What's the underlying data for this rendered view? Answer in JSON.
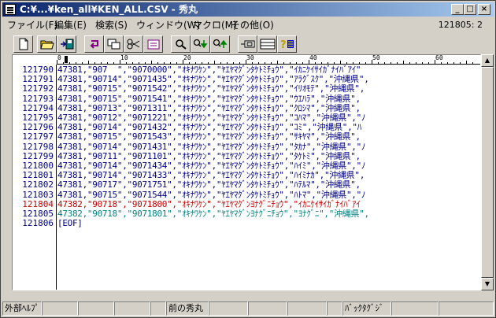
{
  "window": {
    "title": "C:¥...¥ken_all¥KEN_ALL.CSV - 秀丸",
    "minimize": "_",
    "maximize": "□",
    "close": "×"
  },
  "menu": {
    "items": [
      "ファイル(F)",
      "編集(E)",
      "検索(S)",
      "ウィンドウ(W)",
      "マクロ(M)",
      "その他(O)"
    ],
    "position": "121805: 2"
  },
  "toolbar": {
    "icons": [
      "new-file-icon",
      "open-folder-icon",
      "save-icon",
      "undo-icon",
      "copy-icon",
      "cut-icon",
      "paste-icon",
      "search-icon",
      "search-down-icon",
      "search-up-icon",
      "tag-jump-icon",
      "split-window-icon",
      "help-icon"
    ]
  },
  "ruler": {
    "marks": [
      "0",
      "10",
      "20",
      "30",
      "40",
      "50",
      "60"
    ]
  },
  "lines": [
    {
      "no": "121790",
      "text": "47381,\"907  \",\"9070000\",\"ｵｷﾅﾜｹﾝ\",\"ﾔｴﾔﾏｸﾞﾝﾀｹﾄﾐﾁｮｳ\",\"ｲｶﾆｹｲｻｲｶﾞﾅｲﾊﾞｱｲ\""
    },
    {
      "no": "121791",
      "text": "47381,\"90714\",\"9071435\",\"ｵｷﾅﾜｹﾝ\",\"ﾔｴﾔﾏｸﾞﾝﾀｹﾄﾐﾁｮｳ\",\"ｱﾗｸﾞｽｸ\",\"沖縄県\","
    },
    {
      "no": "121792",
      "text": "47381,\"90715\",\"9071542\",\"ｵｷﾅﾜｹﾝ\",\"ﾔｴﾔﾏｸﾞﾝﾀｹﾄﾐﾁｮｳ\",\"ｲﾘｵﾓﾃ\",\"沖縄県\","
    },
    {
      "no": "121793",
      "text": "47381,\"90715\",\"9071541\",\"ｵｷﾅﾜｹﾝ\",\"ﾔｴﾔﾏｸﾞﾝﾀｹﾄﾐﾁｮｳ\",\"ｳｴﾊﾗ\",\"沖縄県\","
    },
    {
      "no": "121794",
      "text": "47381,\"90713\",\"9071311\",\"ｵｷﾅﾜｹﾝ\",\"ﾔｴﾔﾏｸﾞﾝﾀｹﾄﾐﾁｮｳ\",\"ｸﾛｼﾏ\",\"沖縄県\","
    },
    {
      "no": "121795",
      "text": "47381,\"90712\",\"9071221\",\"ｵｷﾅﾜｹﾝ\",\"ﾔｴﾔﾏｸﾞﾝﾀｹﾄﾐﾁｮｳ\",\"ｺﾊﾏ\",\"沖縄県\",\"ﾉ"
    },
    {
      "no": "121796",
      "text": "47381,\"90714\",\"9071432\",\"ｵｷﾅﾜｹﾝ\",\"ﾔｴﾔﾏｸﾞﾝﾀｹﾄﾐﾁｮｳ\",\"ｺﾐ\",\"沖縄県\",\"ﾊ"
    },
    {
      "no": "121797",
      "text": "47381,\"90715\",\"9071543\",\"ｵｷﾅﾜｹﾝ\",\"ﾔｴﾔﾏｸﾞﾝﾀｹﾄﾐﾁｮｳ\",\"ｻｷﾔﾏ\",\"沖縄県\","
    },
    {
      "no": "121798",
      "text": "47381,\"90714\",\"9071431\",\"ｵｷﾅﾜｹﾝ\",\"ﾔｴﾔﾏｸﾞﾝﾀｹﾄﾐﾁｮｳ\",\"ﾀｶﾅ\",\"沖縄県\",\"ﾉ"
    },
    {
      "no": "121799",
      "text": "47381,\"90711\",\"9071101\",\"ｵｷﾅﾜｹﾝ\",\"ﾔｴﾔﾏｸﾞﾝﾀｹﾄﾐﾁｮｳ\",\"ﾀｹﾄﾐ\",\"沖縄県\","
    },
    {
      "no": "121800",
      "text": "47381,\"90714\",\"9071434\",\"ｵｷﾅﾜｹﾝ\",\"ﾔｴﾔﾏｸﾞﾝﾀｹﾄﾐﾁｮｳ\",\"ﾊｲﾐ\",\"沖縄県\",\"ﾉ"
    },
    {
      "no": "121801",
      "text": "47381,\"90714\",\"9071433\",\"ｵｷﾅﾜｹﾝ\",\"ﾔｴﾔﾏｸﾞﾝﾀｹﾄﾐﾁｮｳ\",\"ﾊｲﾐﾅｶ\",\"沖縄県\","
    },
    {
      "no": "121802",
      "text": "47381,\"90717\",\"9071751\",\"ｵｷﾅﾜｹﾝ\",\"ﾔｴﾔﾏｸﾞﾝﾀｹﾄﾐﾁｮｳ\",\"ﾊﾃﾙﾏ\",\"沖縄県\","
    },
    {
      "no": "121803",
      "text": "47381,\"90715\",\"9071544\",\"ｵｷﾅﾜｹﾝ\",\"ﾔｴﾔﾏｸﾞﾝﾀｹﾄﾐﾁｮｳ\",\"ﾊﾄﾏ\",\"沖縄県\",\"ﾉ"
    },
    {
      "no": "121804",
      "text": "47382,\"90718\",\"9071800\",\"ｵｷﾅﾜｹﾝ\",\"ﾔｴﾔﾏｸﾞﾝﾖﾅｸﾞﾆﾁｮｳ\",\"ｲｶﾆｹｲｻｲｶﾞﾅｲﾊﾞｱｲ"
    },
    {
      "no": "121805",
      "text": "47382,\"90718\",\"9071801\",\"ｵｷﾅﾜｹﾝ\",\"ﾔｴﾔﾏｸﾞﾝﾖﾅｸﾞﾆﾁｮｳ\",\"ﾖﾅｸﾞﾆ\",\"沖縄県\","
    },
    {
      "no": "121806",
      "text": "[EOF]"
    }
  ],
  "current_line": 15,
  "eof_line": 16,
  "statusbar": {
    "keys": [
      "外部ﾍﾙﾌﾟ",
      "",
      "",
      "",
      "",
      "前の秀丸",
      "",
      "",
      "",
      "",
      "ﾊﾞｯｸﾀｸﾞｼﾞ",
      "",
      ""
    ]
  },
  "colors": {
    "text": "#000080",
    "current": "#c00000",
    "eof": "#008080",
    "titlebar": "#0a246a"
  }
}
